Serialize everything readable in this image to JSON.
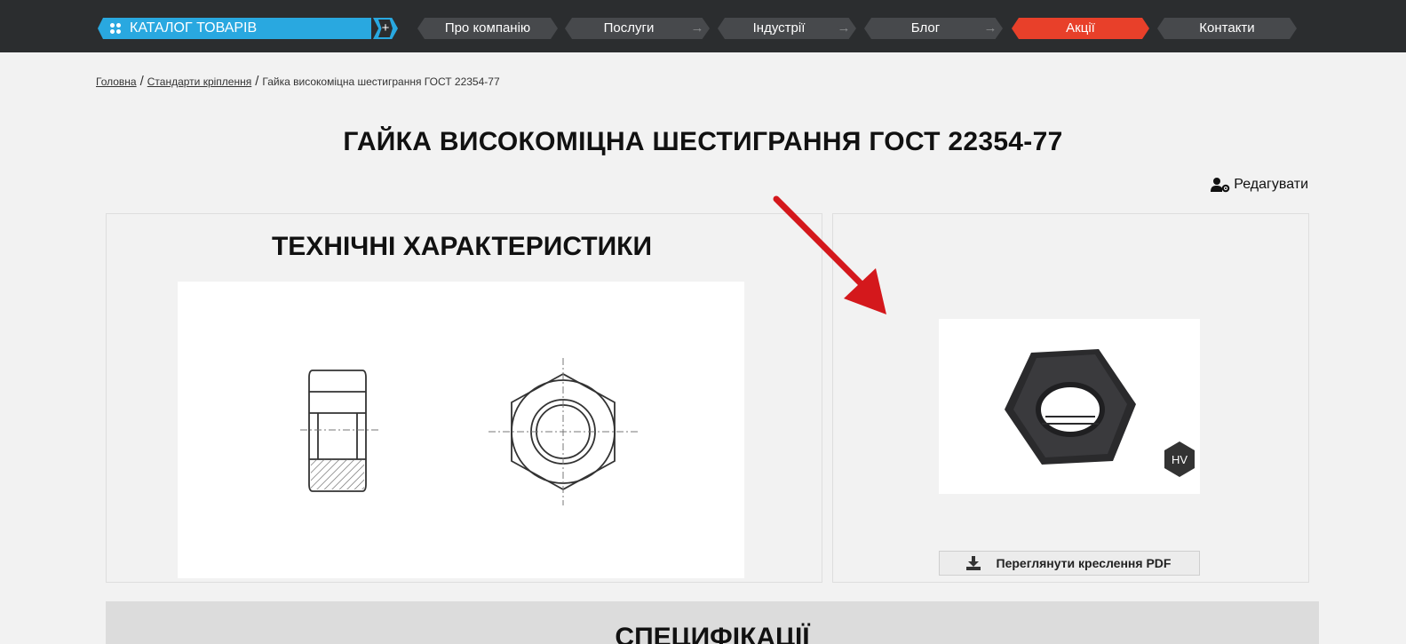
{
  "nav": {
    "catalog_label": "КАТАЛОГ ТОВАРІВ",
    "catalog_plus": "+",
    "items": [
      {
        "label": "Про компанію"
      },
      {
        "label": "Послуги"
      },
      {
        "label": "Індустрії"
      },
      {
        "label": "Блог"
      },
      {
        "label": "Акції"
      },
      {
        "label": "Контакти"
      }
    ],
    "arrow_glyph": "→",
    "accent_color": "#29a8e0",
    "active_color": "#e8402a"
  },
  "breadcrumb": {
    "home": "Головна",
    "section": "Стандарти кріплення",
    "current": "Гайка високоміцна шестиграння ГОСТ 22354-77",
    "separator": "/"
  },
  "page_title": "ГАЙКА ВИСОКОМІЦНА ШЕСТИГРАННЯ ГОСТ 22354-77",
  "edit_label": "Редагувати",
  "tech": {
    "title": "ТЕХНІЧНІ ХАРАКТЕРИСТИКИ"
  },
  "product": {
    "badge": "HV",
    "pdf_label": "Переглянути креслення PDF"
  },
  "specs_title": "СПЕЦИФІКАЦІЇ"
}
